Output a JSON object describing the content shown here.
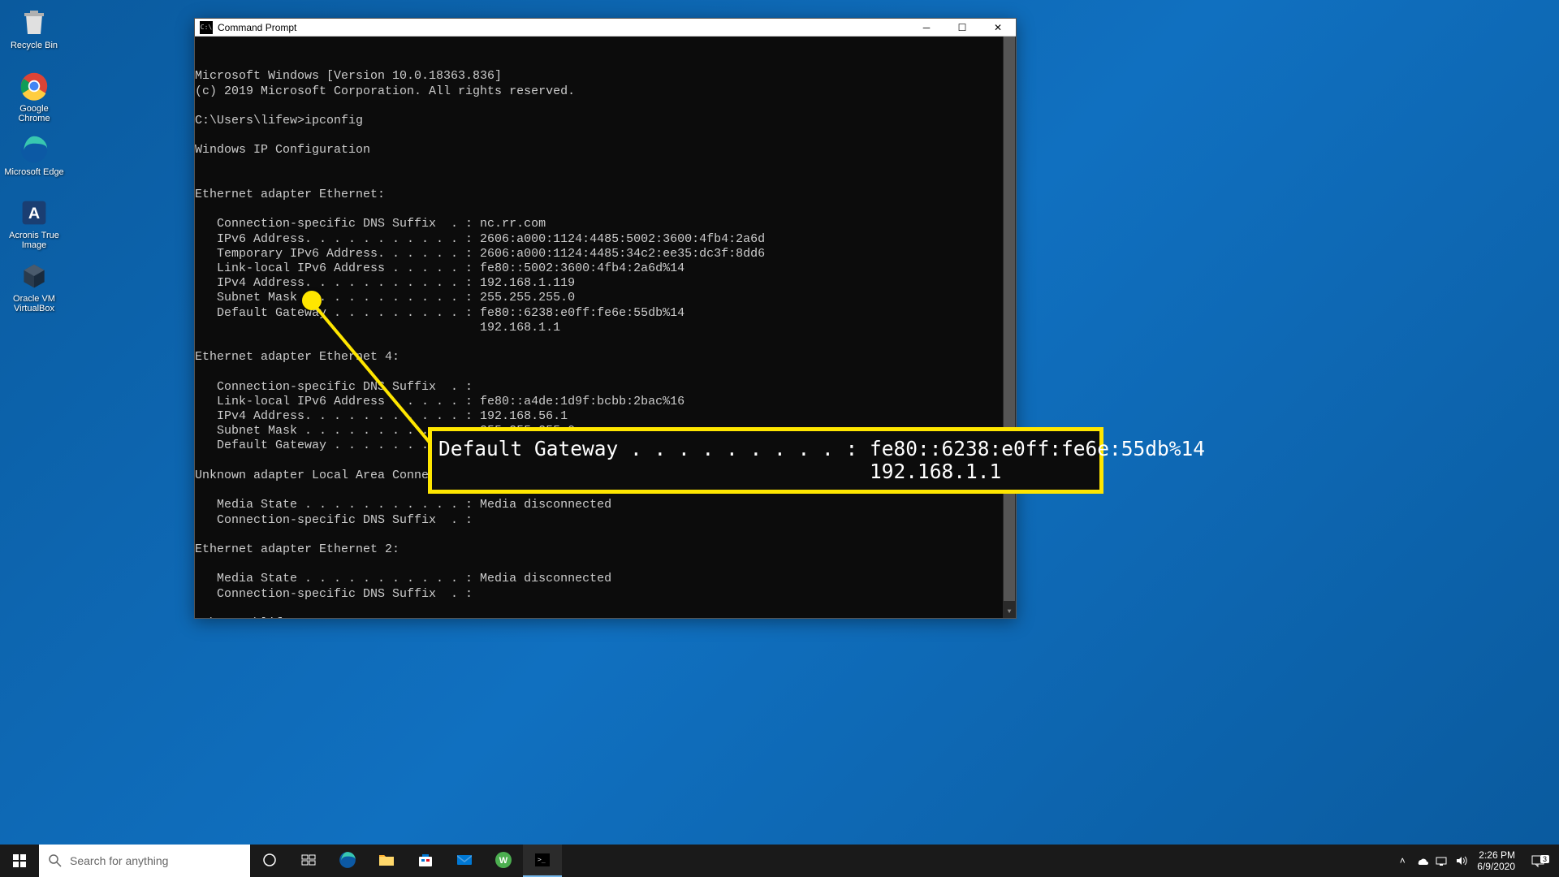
{
  "desktop": {
    "icons": [
      {
        "name": "recycle-bin",
        "label": "Recycle Bin",
        "glyph": "recycle"
      },
      {
        "name": "google-chrome",
        "label": "Google Chrome",
        "glyph": "chrome"
      },
      {
        "name": "microsoft-edge",
        "label": "Microsoft Edge",
        "glyph": "edge"
      },
      {
        "name": "acronis-true-image",
        "label": "Acronis True Image",
        "glyph": "acronis"
      },
      {
        "name": "oracle-vm-virtualbox",
        "label": "Oracle VM VirtualBox",
        "glyph": "virtualbox"
      }
    ]
  },
  "window": {
    "title": "Command Prompt",
    "terminal_lines": [
      "Microsoft Windows [Version 10.0.18363.836]",
      "(c) 2019 Microsoft Corporation. All rights reserved.",
      "",
      "C:\\Users\\lifew>ipconfig",
      "",
      "Windows IP Configuration",
      "",
      "",
      "Ethernet adapter Ethernet:",
      "",
      "   Connection-specific DNS Suffix  . : nc.rr.com",
      "   IPv6 Address. . . . . . . . . . . : 2606:a000:1124:4485:5002:3600:4fb4:2a6d",
      "   Temporary IPv6 Address. . . . . . : 2606:a000:1124:4485:34c2:ee35:dc3f:8dd6",
      "   Link-local IPv6 Address . . . . . : fe80::5002:3600:4fb4:2a6d%14",
      "   IPv4 Address. . . . . . . . . . . : 192.168.1.119",
      "   Subnet Mask . . . . . . . . . . . : 255.255.255.0",
      "   Default Gateway . . . . . . . . . : fe80::6238:e0ff:fe6e:55db%14",
      "                                       192.168.1.1",
      "",
      "Ethernet adapter Ethernet 4:",
      "",
      "   Connection-specific DNS Suffix  . :",
      "   Link-local IPv6 Address . . . . . : fe80::a4de:1d9f:bcbb:2bac%16",
      "   IPv4 Address. . . . . . . . . . . : 192.168.56.1",
      "   Subnet Mask . . . . . . . . . . . : 255.255.255.0",
      "   Default Gateway . . . . . . . . . :",
      "",
      "Unknown adapter Local Area Connection:",
      "",
      "   Media State . . . . . . . . . . . : Media disconnected",
      "   Connection-specific DNS Suffix  . :",
      "",
      "Ethernet adapter Ethernet 2:",
      "",
      "   Media State . . . . . . . . . . . : Media disconnected",
      "   Connection-specific DNS Suffix  . :",
      ""
    ],
    "prompt": "C:\\Users\\lifew>"
  },
  "callout": {
    "line1": "Default Gateway . . . . . . . . . : fe80::6238:e0ff:fe6e:55db%14",
    "line2": "                                    192.168.1.1"
  },
  "taskbar": {
    "search_placeholder": "Search for anything",
    "clock_time": "2:26 PM",
    "clock_date": "6/9/2020",
    "notif_count": "3"
  }
}
